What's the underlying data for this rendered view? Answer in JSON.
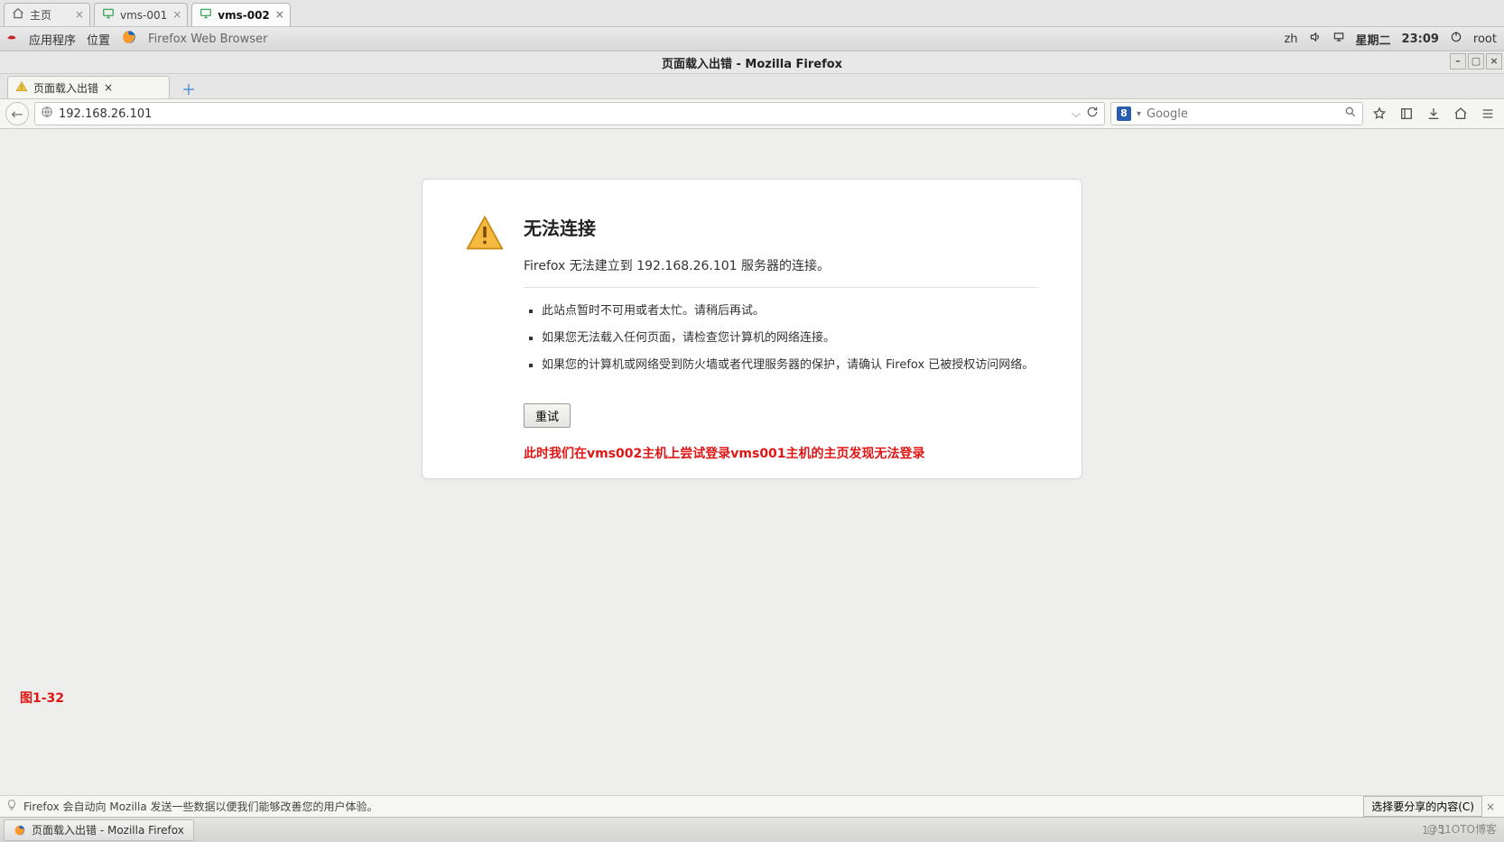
{
  "vm_tabs": [
    {
      "label": "主页",
      "icon": "home",
      "active": false
    },
    {
      "label": "vms-001",
      "icon": "monitor",
      "active": false
    },
    {
      "label": "vms-002",
      "icon": "monitor",
      "active": true
    }
  ],
  "gnome": {
    "apps": "应用程序",
    "places": "位置",
    "ff_tooltip": "Firefox Web Browser",
    "lang": "zh",
    "day": "星期二",
    "time": "23:09",
    "user": "root"
  },
  "ff_title": "页面载入出错  -  Mozilla Firefox",
  "ff_tab": {
    "label": "页面载入出错"
  },
  "url": "192.168.26.101",
  "search_placeholder": "Google",
  "error": {
    "title": "无法连接",
    "message": "Firefox 无法建立到 192.168.26.101 服务器的连接。",
    "bullets": [
      "此站点暂时不可用或者太忙。请稍后再试。",
      "如果您无法载入任何页面，请检查您计算机的网络连接。",
      "如果您的计算机或网络受到防火墙或者代理服务器的保护，请确认 Firefox 已被授权访问网络。"
    ],
    "retry": "重试",
    "red_note": "此时我们在vms002主机上尝试登录vms001主机的主页发现无法登录"
  },
  "figure_label": "图1-32",
  "privacy": {
    "text": "Firefox 会自动向 Mozilla 发送一些数据以便我们能够改善您的用户体验。",
    "choose": "选择要分享的内容(C)"
  },
  "taskbar": {
    "app": "页面载入出错 - Mozilla Firefox"
  },
  "watermark": "@51OTO博客",
  "page_no": "1 / 1"
}
